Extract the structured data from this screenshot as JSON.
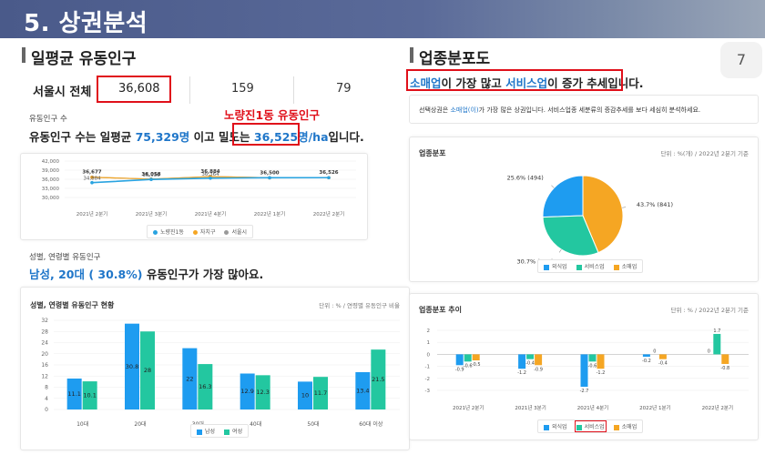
{
  "header": {
    "title": "5. 상권분석"
  },
  "page_number": "7",
  "left": {
    "section_title": "일평균 유동인구",
    "stats": {
      "label": "서울시 전체",
      "v1": "36,608",
      "v2": "159",
      "v3": "79"
    },
    "red_note": "노량진1동 유동인구",
    "caption1": "유동인구 수",
    "headline1": {
      "pre": "유동인구 수는 일평균 ",
      "num": "75,329명",
      "mid": " 이고 밀도는 ",
      "density": "36,525명/ha",
      "post": "입니다."
    },
    "caption2": "성별, 연령별 유동인구",
    "headline2": {
      "pre": "남성, 20대 ( 30.8%)",
      "post": " 유동인구가 가장 많아요."
    }
  },
  "line_chart": {
    "legend": [
      "노량진1동",
      "자치구",
      "서울시"
    ],
    "colors": {
      "dong": "#29a3e0",
      "gu": "#f5a623",
      "seoul": "#9a9a9a"
    }
  },
  "bar_chart": {
    "title": "성별, 연령별 유동인구 현황",
    "unit": "단위 : % / 연령별 유동인구 비율",
    "legend": [
      "남성",
      "여성"
    ],
    "colors": {
      "male": "#1e9cf0",
      "female": "#23c7a0"
    }
  },
  "right": {
    "section_title": "업종분포도",
    "headline": {
      "a": "소매업",
      "b": "이 가장 많고 ",
      "c": "서비스업",
      "d": "이 증가 추세입니다."
    },
    "desc": {
      "pre": "선택상권은 ",
      "hl": "소매업(이)",
      "post": "가 가장 많은 상권입니다. 서비스업종 세분류의 증감추세를 보다 세심히 분석하세요."
    },
    "pie_card": {
      "title": "업종분포",
      "unit": "단위 : %(개) / 2022년 2분기 기준",
      "legend": [
        "외식업",
        "서비스업",
        "소매업"
      ]
    },
    "trend_card": {
      "title": "업종분포 추이",
      "unit": "단위 : % / 2022년 2분기 기준",
      "legend": [
        "외식업",
        "서비스업",
        "소매업"
      ]
    }
  },
  "chart_data": [
    {
      "type": "line",
      "categories": [
        "2021년 2분기",
        "2021년 3분기",
        "2021년 4분기",
        "2022년 1분기",
        "2022년 2분기"
      ],
      "ylim": [
        30000,
        42000
      ],
      "yticks": [
        "42,000",
        "39,000",
        "36,000",
        "33,000",
        "30,000"
      ],
      "series": [
        {
          "name": "노량진1동",
          "values": [
            34884,
            35936,
            36364,
            36500,
            36525
          ],
          "labels": [
            "34,884",
            "35,936",
            "36,364",
            "",
            ""
          ]
        },
        {
          "name": "자치구",
          "values": [
            36677,
            36058,
            36884,
            36500,
            36526
          ],
          "labels": [
            "36,677",
            "36,058",
            "36,884",
            "36,500",
            "36,526"
          ]
        },
        {
          "name": "서울시",
          "values": [
            36677,
            36058,
            36884,
            36500,
            36526
          ],
          "labels": [
            "",
            "",
            "",
            "",
            ""
          ]
        }
      ]
    },
    {
      "type": "bar",
      "categories": [
        "10대",
        "20대",
        "30대",
        "40대",
        "50대",
        "60대 이상"
      ],
      "ylim": [
        0,
        32
      ],
      "yticks": [
        0,
        4,
        8,
        12,
        16,
        20,
        24,
        28,
        32
      ],
      "series": [
        {
          "name": "남성",
          "values": [
            11.1,
            30.8,
            22,
            12.9,
            10,
            13.4
          ]
        },
        {
          "name": "여성",
          "values": [
            10.1,
            28,
            16.3,
            12.3,
            11.7,
            21.5
          ]
        }
      ]
    },
    {
      "type": "pie",
      "slices": [
        {
          "name": "외식업",
          "value": 25.6,
          "count": 494,
          "label": "25.6% (494)",
          "color": "#1e9cf0"
        },
        {
          "name": "서비스업",
          "value": 30.7,
          "count": 591,
          "label": "30.7% (591)",
          "color": "#23c7a0"
        },
        {
          "name": "소매업",
          "value": 43.7,
          "count": 841,
          "label": "43.7% (841)",
          "color": "#f5a623"
        }
      ]
    },
    {
      "type": "bar",
      "categories": [
        "2021년 2분기",
        "2021년 3분기",
        "2021년 4분기",
        "2022년 1분기",
        "2022년 2분기"
      ],
      "ylim": [
        -3,
        2
      ],
      "yticks": [
        2,
        1,
        0,
        -1,
        -2,
        -3
      ],
      "series": [
        {
          "name": "외식업",
          "values": [
            -0.9,
            -1.2,
            -2.7,
            -0.2,
            0
          ],
          "color": "#1e9cf0"
        },
        {
          "name": "서비스업",
          "values": [
            -0.6,
            -0.4,
            -0.6,
            0,
            1.7
          ],
          "color": "#23c7a0"
        },
        {
          "name": "소매업",
          "values": [
            -0.5,
            -0.9,
            -1.2,
            -0.4,
            -0.8
          ],
          "color": "#f5a623"
        }
      ]
    }
  ]
}
